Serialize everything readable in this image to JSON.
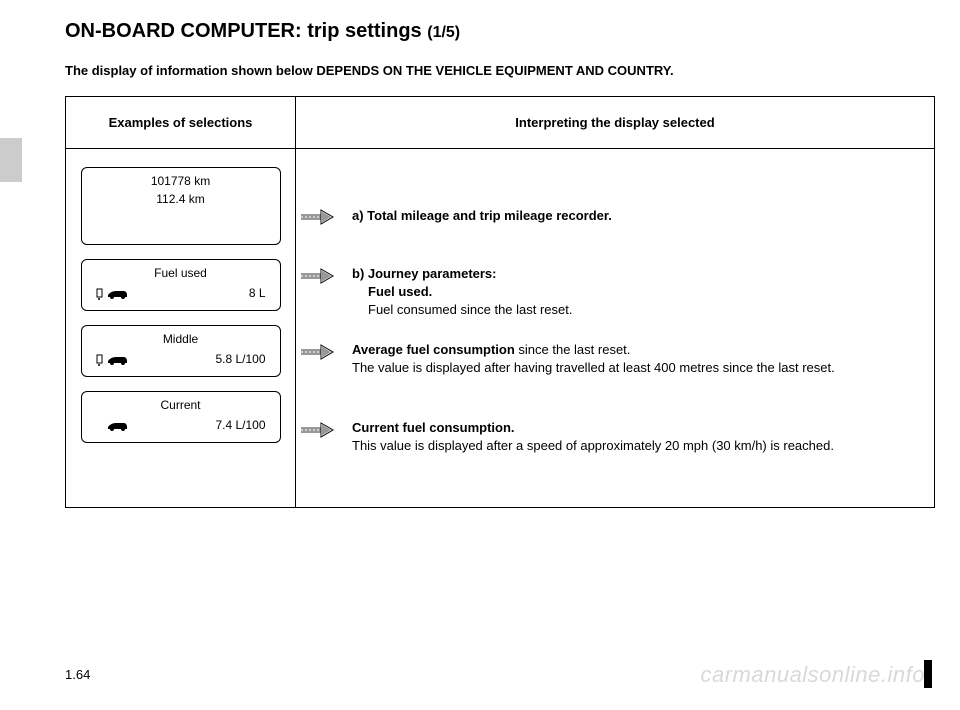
{
  "title": {
    "main": "ON-BOARD COMPUTER: trip settings",
    "sub": "(1/5)"
  },
  "subtitle": "The display of information shown below DEPENDS ON THE VEHICLE EQUIPMENT AND COUNTRY.",
  "headers": {
    "left": "Examples of selections",
    "right": "Interpreting the display selected"
  },
  "displays": {
    "d1": {
      "line1": "101778 km",
      "line2": "112.4 km"
    },
    "d2": {
      "title": "Fuel used",
      "value": "8 L"
    },
    "d3": {
      "title": "Middle",
      "value": "5.8 L/100"
    },
    "d4": {
      "title": "Current",
      "value": "7.4 L/100"
    }
  },
  "entries": {
    "a": {
      "label": "a) Total mileage and trip mileage recorder."
    },
    "b": {
      "label": "b) Journey parameters:",
      "sub1": "Fuel used.",
      "sub2": "Fuel consumed since the last reset."
    },
    "c": {
      "lead": "Average fuel consumption",
      "cont": " since the last reset.",
      "line2": "The value is displayed after having travelled at least 400 metres since the last reset."
    },
    "d": {
      "lead": "Current fuel consumption.",
      "line2": "This value is displayed after a speed of approximately 20 mph (30 km/h) is reached."
    }
  },
  "pageNumber": "1.64",
  "watermark": "carmanualsonline.info"
}
